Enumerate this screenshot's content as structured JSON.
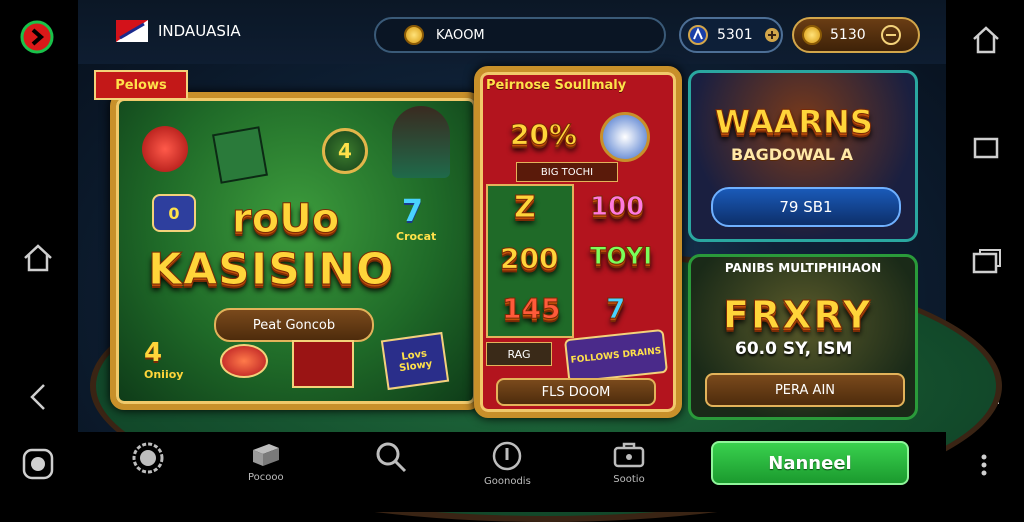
{
  "header": {
    "region_label": "INDAUASIA",
    "search_text": "KAOOM",
    "balance_one": "5301",
    "balance_two": "5130"
  },
  "main_banner": {
    "corner_tag": "Pelows",
    "title_small": "roUo",
    "title_big": "KASISINO",
    "play_button": "Peat Goncob",
    "sticker_four": "4",
    "sticker_zero": "0",
    "sticker_seven": "7",
    "sticker_text": "Crocat",
    "bottom_left_badge": "4",
    "bottom_left_sub": "Oniioy",
    "bottom_right_sticker": "Lovs Slowy"
  },
  "mid_panel": {
    "title": "Peirnose Soullmaly",
    "rate": "20%",
    "sub_label": "BIG TOCHI",
    "left_col": [
      "Z",
      "200",
      "145"
    ],
    "right_col": [
      "100",
      "TOYI",
      "7"
    ],
    "small_tag": "RAG",
    "sticker": "FOLLOWS DRAINS",
    "bottom_button": "FLS DOOM"
  },
  "right_top": {
    "title_line1": "WAARNS",
    "title_line2": "BAGDOWAL A",
    "button": "79 SB1"
  },
  "right_bottom": {
    "header": "PANIBS MULTIPHIHAON",
    "title": "FRXRY",
    "value": "60.0 SY, ISM",
    "button": "PERA AIN"
  },
  "bottom_nav": {
    "items": [
      {
        "label": ""
      },
      {
        "label": "Pocooo"
      },
      {
        "label": ""
      },
      {
        "label": "Goonodis"
      },
      {
        "label": "Sootio"
      }
    ],
    "cta_label": "Nanneel"
  },
  "colors": {
    "gold": "#c8902a",
    "green_cta": "#22b53b",
    "teal_border": "#2aa7a0",
    "red_panel": "#b3141e"
  },
  "icons": {
    "left_top": "red-arrow-right-icon",
    "left_mid": "home-icon",
    "left_back": "back-chevron-icon",
    "left_bottom": "record-icon",
    "right_top": "home-outline-icon",
    "right_square": "recent-square-icon",
    "right_pip": "pip-icon",
    "right_menu": "menu-lines-icon",
    "right_more": "more-dots-icon"
  }
}
